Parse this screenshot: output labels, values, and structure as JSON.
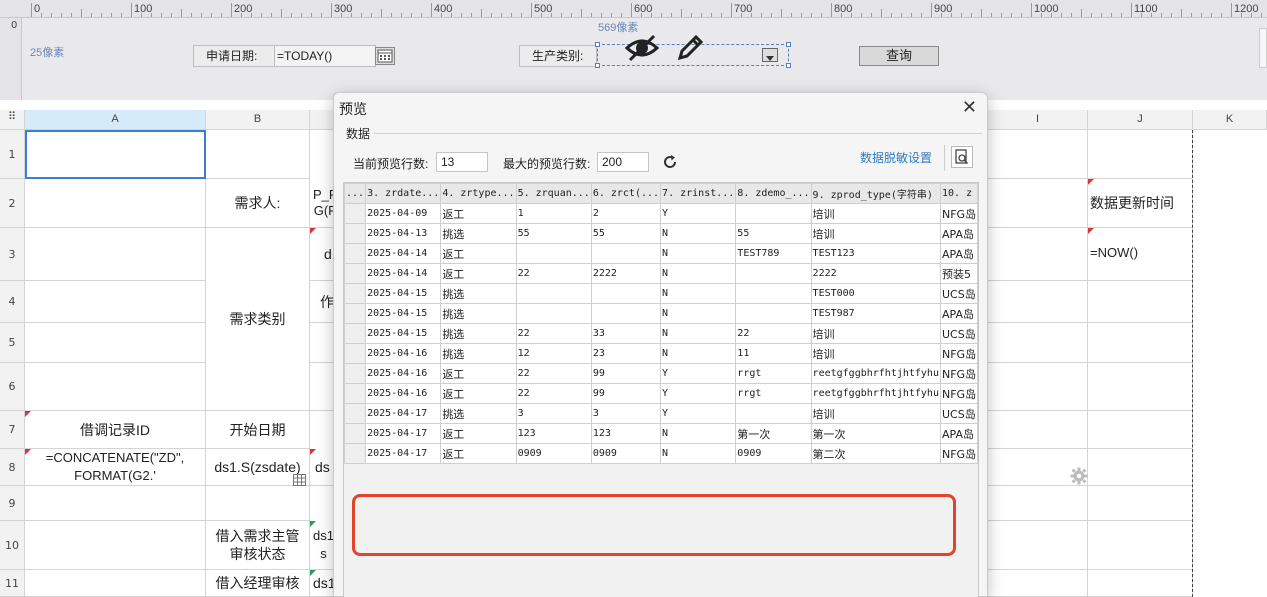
{
  "ruler": {
    "labels": [
      "0",
      "100",
      "200",
      "300",
      "400",
      "500",
      "600",
      "700",
      "800",
      "900",
      "1000",
      "1100",
      "1200"
    ],
    "v_label": "0"
  },
  "param": {
    "px25": "25像素",
    "px569": "569像素",
    "date_label": "申请日期:",
    "date_value": "=TODAY()",
    "cat_label": "生产类别:",
    "query_btn": "查询"
  },
  "grid": {
    "cols": [
      "A",
      "B",
      "I",
      "J",
      "K"
    ],
    "rows": [
      "1",
      "2",
      "3",
      "4",
      "5",
      "6",
      "7",
      "8",
      "9",
      "10",
      "11"
    ],
    "b2": "需求人:",
    "b3": "需求类别",
    "b7": "开始日期",
    "b8": "ds1.S(zsdate)",
    "b10": "借入需求主管审核状态",
    "b11": "借入经理审核",
    "a7": "借调记录ID",
    "a8": "=CONCATENATE(\"ZD\", FORMAT(G2.'",
    "c2": "P_F G(F",
    "c3": "d",
    "c4": "作",
    "c8": "ds",
    "c10": "ds1 s",
    "c11": "ds1",
    "j2": "数据更新时间",
    "j3": "=NOW()"
  },
  "dialog": {
    "title": "预览",
    "close": "✕",
    "group": "数据",
    "cur_label": "当前预览行数:",
    "cur_value": "13",
    "max_label": "最大的预览行数:",
    "max_value": "200",
    "mask": "数据脱敏设置",
    "columns": [
      "...",
      "3. zrdate...",
      "4. zrtype...",
      "5. zrquan...",
      "6. zrct(...",
      "7. zrinst...",
      "8. zdemo_...",
      "9. zprod_type(字符串)",
      "10. z"
    ],
    "rows": [
      [
        "",
        "2025-04-09",
        "返工",
        "1",
        "2",
        "Y",
        "",
        "培训",
        "NFG岛"
      ],
      [
        "",
        "2025-04-13",
        "挑选",
        "55",
        "55",
        "N",
        "55",
        "培训",
        "APA岛"
      ],
      [
        "",
        "2025-04-14",
        "返工",
        "",
        "",
        "N",
        "TEST789",
        "TEST123",
        "APA岛"
      ],
      [
        "",
        "2025-04-14",
        "返工",
        "22",
        "2222",
        "N",
        "",
        "2222",
        "预装5"
      ],
      [
        "",
        "2025-04-15",
        "挑选",
        "",
        "",
        "N",
        "",
        "TEST000",
        "UCS岛"
      ],
      [
        "",
        "2025-04-15",
        "挑选",
        "",
        "",
        "N",
        "",
        "TEST987",
        "APA岛"
      ],
      [
        "",
        "2025-04-15",
        "挑选",
        "22",
        "33",
        "N",
        "22",
        "培训",
        "UCS岛"
      ],
      [
        "",
        "2025-04-16",
        "挑选",
        "12",
        "23",
        "N",
        "11",
        "培训",
        "NFG岛"
      ],
      [
        "",
        "2025-04-16",
        "返工",
        "22",
        "99",
        "Y",
        "rrgt",
        "reetgfggbhrfhtjhtfyhu",
        "NFG岛"
      ],
      [
        "",
        "2025-04-16",
        "返工",
        "22",
        "99",
        "Y",
        "rrgt",
        "reetgfggbhrfhtjhtfyhu",
        "NFG岛"
      ],
      [
        "",
        "2025-04-17",
        "挑选",
        "3",
        "3",
        "Y",
        "",
        "培训",
        "UCS岛"
      ],
      [
        "",
        "2025-04-17",
        "返工",
        "123",
        "123",
        "N",
        "第一次",
        "第一次",
        "APA岛"
      ],
      [
        "",
        "2025-04-17",
        "返工",
        "0909",
        "0909",
        "N",
        "0909",
        "第二次",
        "NFG岛"
      ]
    ]
  },
  "colors": {
    "highlight": "#e0452c",
    "link": "#2f7cc0",
    "selected_header": "#d6ebf9"
  }
}
